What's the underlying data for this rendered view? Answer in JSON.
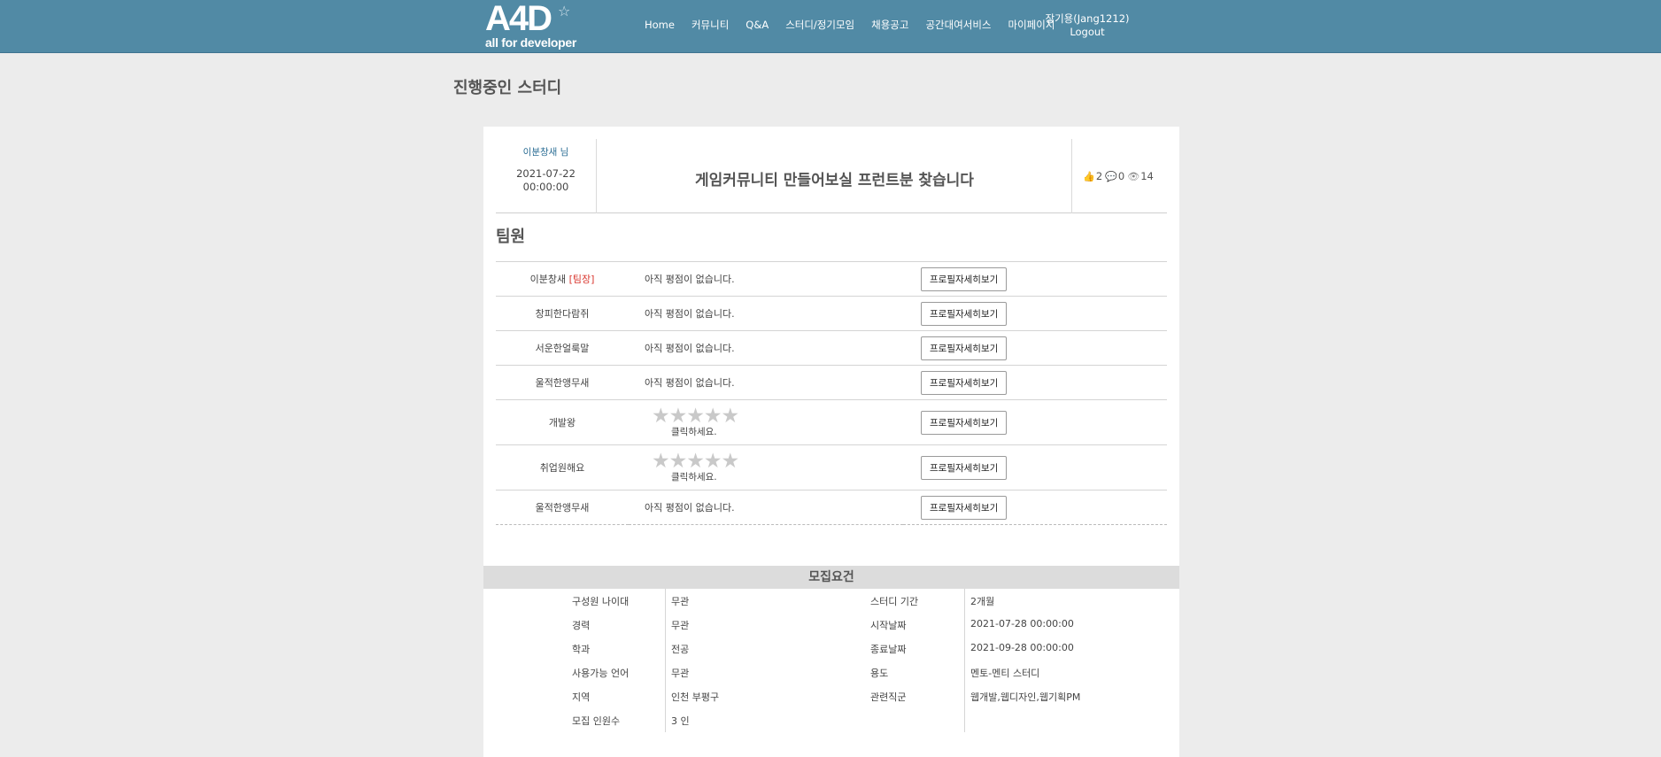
{
  "header": {
    "logo_text": "A4D",
    "logo_sub": "all for developer",
    "logo_star_icon": "sparkle-icon",
    "nav": [
      {
        "label": "Home"
      },
      {
        "label": "커뮤니티"
      },
      {
        "label": "Q&A"
      },
      {
        "label": "스터디/정기모임"
      },
      {
        "label": "채용공고"
      },
      {
        "label": "공간대여서비스"
      },
      {
        "label": "마이페이지"
      }
    ],
    "user_name": "장기용(Jang1212)",
    "logout_label": "Logout"
  },
  "page_title": "진행중인 스터디",
  "post": {
    "author": "이분창새 님",
    "date": "2021-07-22",
    "time": "00:00:00",
    "title": "게임커뮤니티 만들어보실 프런트분 찾습니다",
    "likes": "2",
    "comments": "0",
    "views": "14"
  },
  "team": {
    "heading": "팀원",
    "leader_tag": "[팀장]",
    "profile_button": "프로필자세히보기",
    "no_rating_text": "아직 평점이 없습니다.",
    "click_hint": "클릭하세요.",
    "members": [
      {
        "name": "이분창새",
        "leader": true,
        "rating_type": "text"
      },
      {
        "name": "창피한다람쥐",
        "leader": false,
        "rating_type": "text"
      },
      {
        "name": "서운한얼룩말",
        "leader": false,
        "rating_type": "text"
      },
      {
        "name": "울적한앵무새",
        "leader": false,
        "rating_type": "text"
      },
      {
        "name": "개발왕",
        "leader": false,
        "rating_type": "stars",
        "stars": 0
      },
      {
        "name": "취업원해요",
        "leader": false,
        "rating_type": "stars",
        "stars": 0
      },
      {
        "name": "울적한앵무새",
        "leader": false,
        "rating_type": "text"
      }
    ]
  },
  "requirements": {
    "heading": "모집요건",
    "rows": [
      {
        "k1": "구성원 나이대",
        "v1": "무관",
        "k2": "스터디 기간",
        "v2": "2개월"
      },
      {
        "k1": "경력",
        "v1": "무관",
        "k2": "시작날짜",
        "v2": "2021-07-28 00:00:00"
      },
      {
        "k1": "학과",
        "v1": "전공",
        "k2": "종료날짜",
        "v2": "2021-09-28 00:00:00"
      },
      {
        "k1": "사용가능 언어",
        "v1": "무관",
        "k2": "용도",
        "v2": "멘토-멘티 스터디"
      },
      {
        "k1": "지역",
        "v1": "인천 부평구",
        "k2": "관련직군",
        "v2": "웹개발,웹디자인,웹기획PM"
      },
      {
        "k1": "모집 인원수",
        "v1": "3 인",
        "k2": "",
        "v2": ""
      }
    ]
  },
  "colors": {
    "header_bg": "#518aa5",
    "leader_tag": "#d9352d",
    "author_link": "#2b6d94"
  }
}
